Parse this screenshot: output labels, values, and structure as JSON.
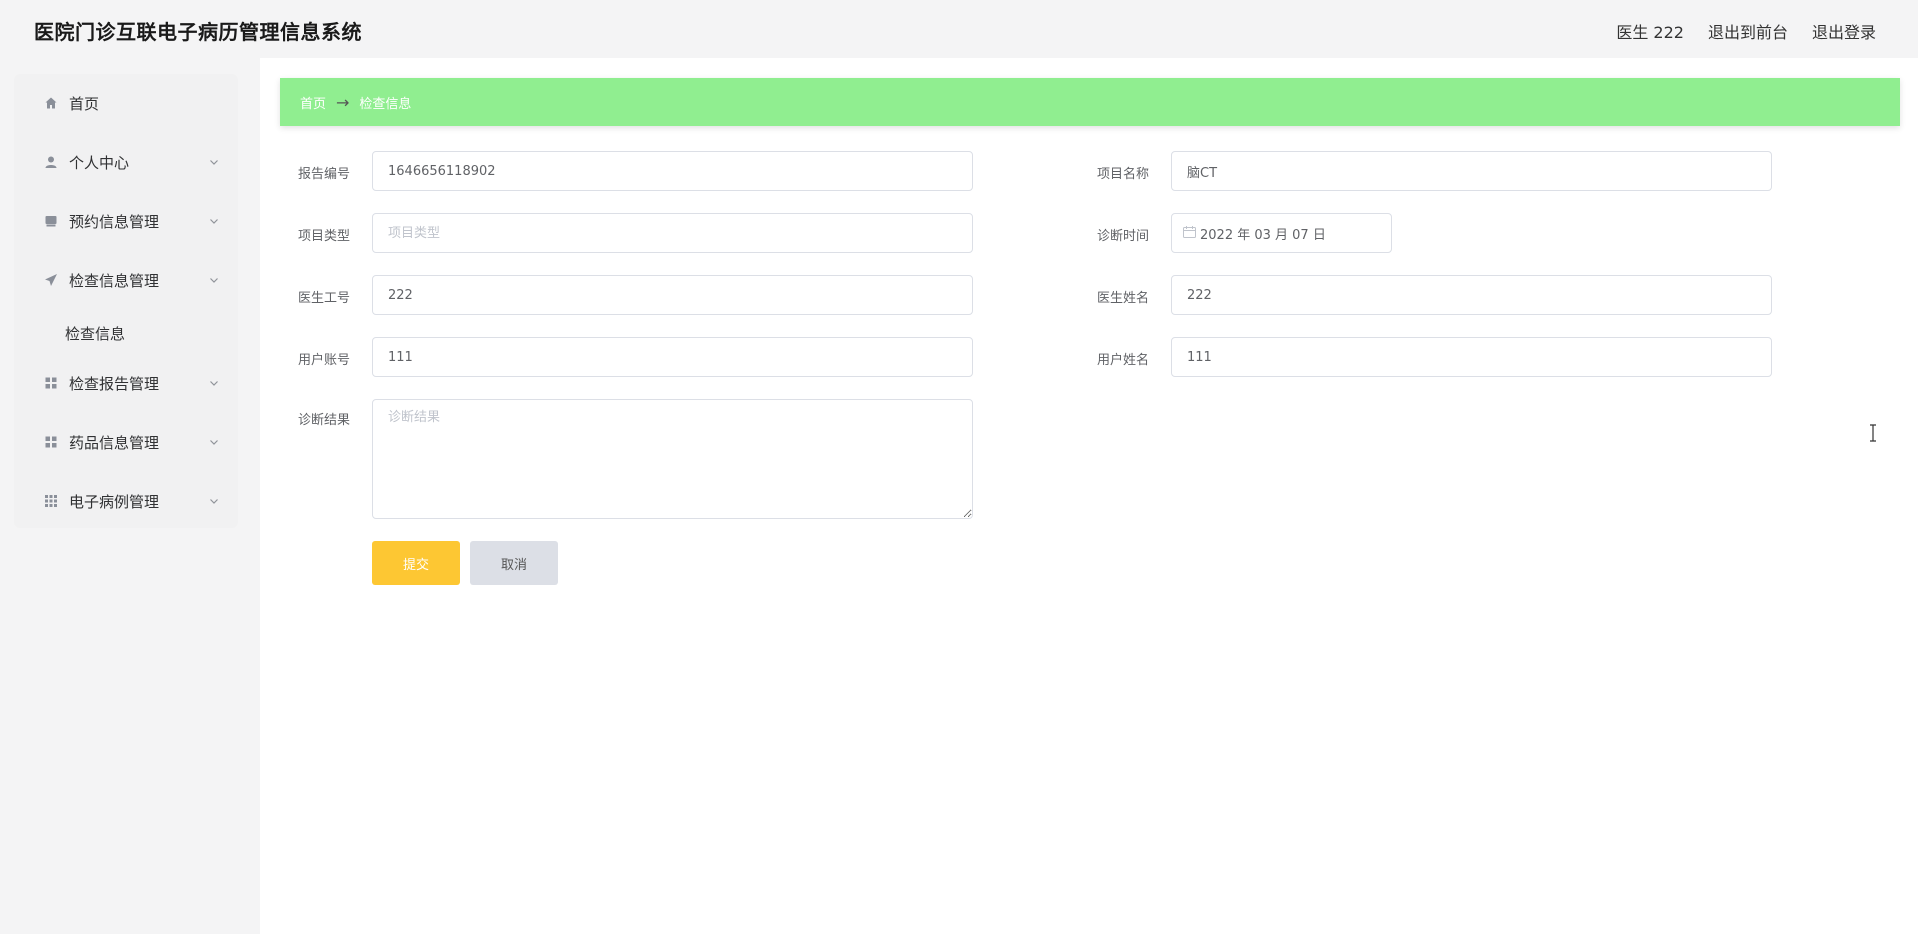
{
  "header": {
    "title": "医院门诊互联电子病历管理信息系统",
    "user_label": "医生 222",
    "exit_front_label": "退出到前台",
    "logout_label": "退出登录"
  },
  "sidebar": {
    "items": [
      {
        "label": "首页",
        "icon": "home-icon"
      },
      {
        "label": "个人中心",
        "icon": "user-icon"
      },
      {
        "label": "预约信息管理",
        "icon": "calendar-icon"
      },
      {
        "label": "检查信息管理",
        "icon": "send-icon"
      },
      {
        "label": "检查报告管理",
        "icon": "grid-icon"
      },
      {
        "label": "药品信息管理",
        "icon": "grid-icon"
      },
      {
        "label": "电子病例管理",
        "icon": "apps-icon"
      }
    ],
    "subitem": "检查信息"
  },
  "breadcrumb": {
    "home": "首页",
    "separator": "→",
    "current": "检查信息"
  },
  "form": {
    "report_no": {
      "label": "报告编号",
      "value": "1646656118902"
    },
    "item_name": {
      "label": "项目名称",
      "value": "脑CT"
    },
    "item_type": {
      "label": "项目类型",
      "placeholder": "项目类型",
      "value": ""
    },
    "diag_time": {
      "label": "诊断时间",
      "value": "2022 年 03 月 07 日"
    },
    "doctor_no": {
      "label": "医生工号",
      "value": "222"
    },
    "doctor_name": {
      "label": "医生姓名",
      "value": "222"
    },
    "user_account": {
      "label": "用户账号",
      "value": "111"
    },
    "user_name": {
      "label": "用户姓名",
      "value": "111"
    },
    "diag_result": {
      "label": "诊断结果",
      "placeholder": "诊断结果",
      "value": ""
    },
    "submit_label": "提交",
    "cancel_label": "取消"
  },
  "colors": {
    "breadcrumb_bg": "#90ee90",
    "submit_bg": "#fdc733",
    "cancel_bg": "#dcdfe6"
  }
}
